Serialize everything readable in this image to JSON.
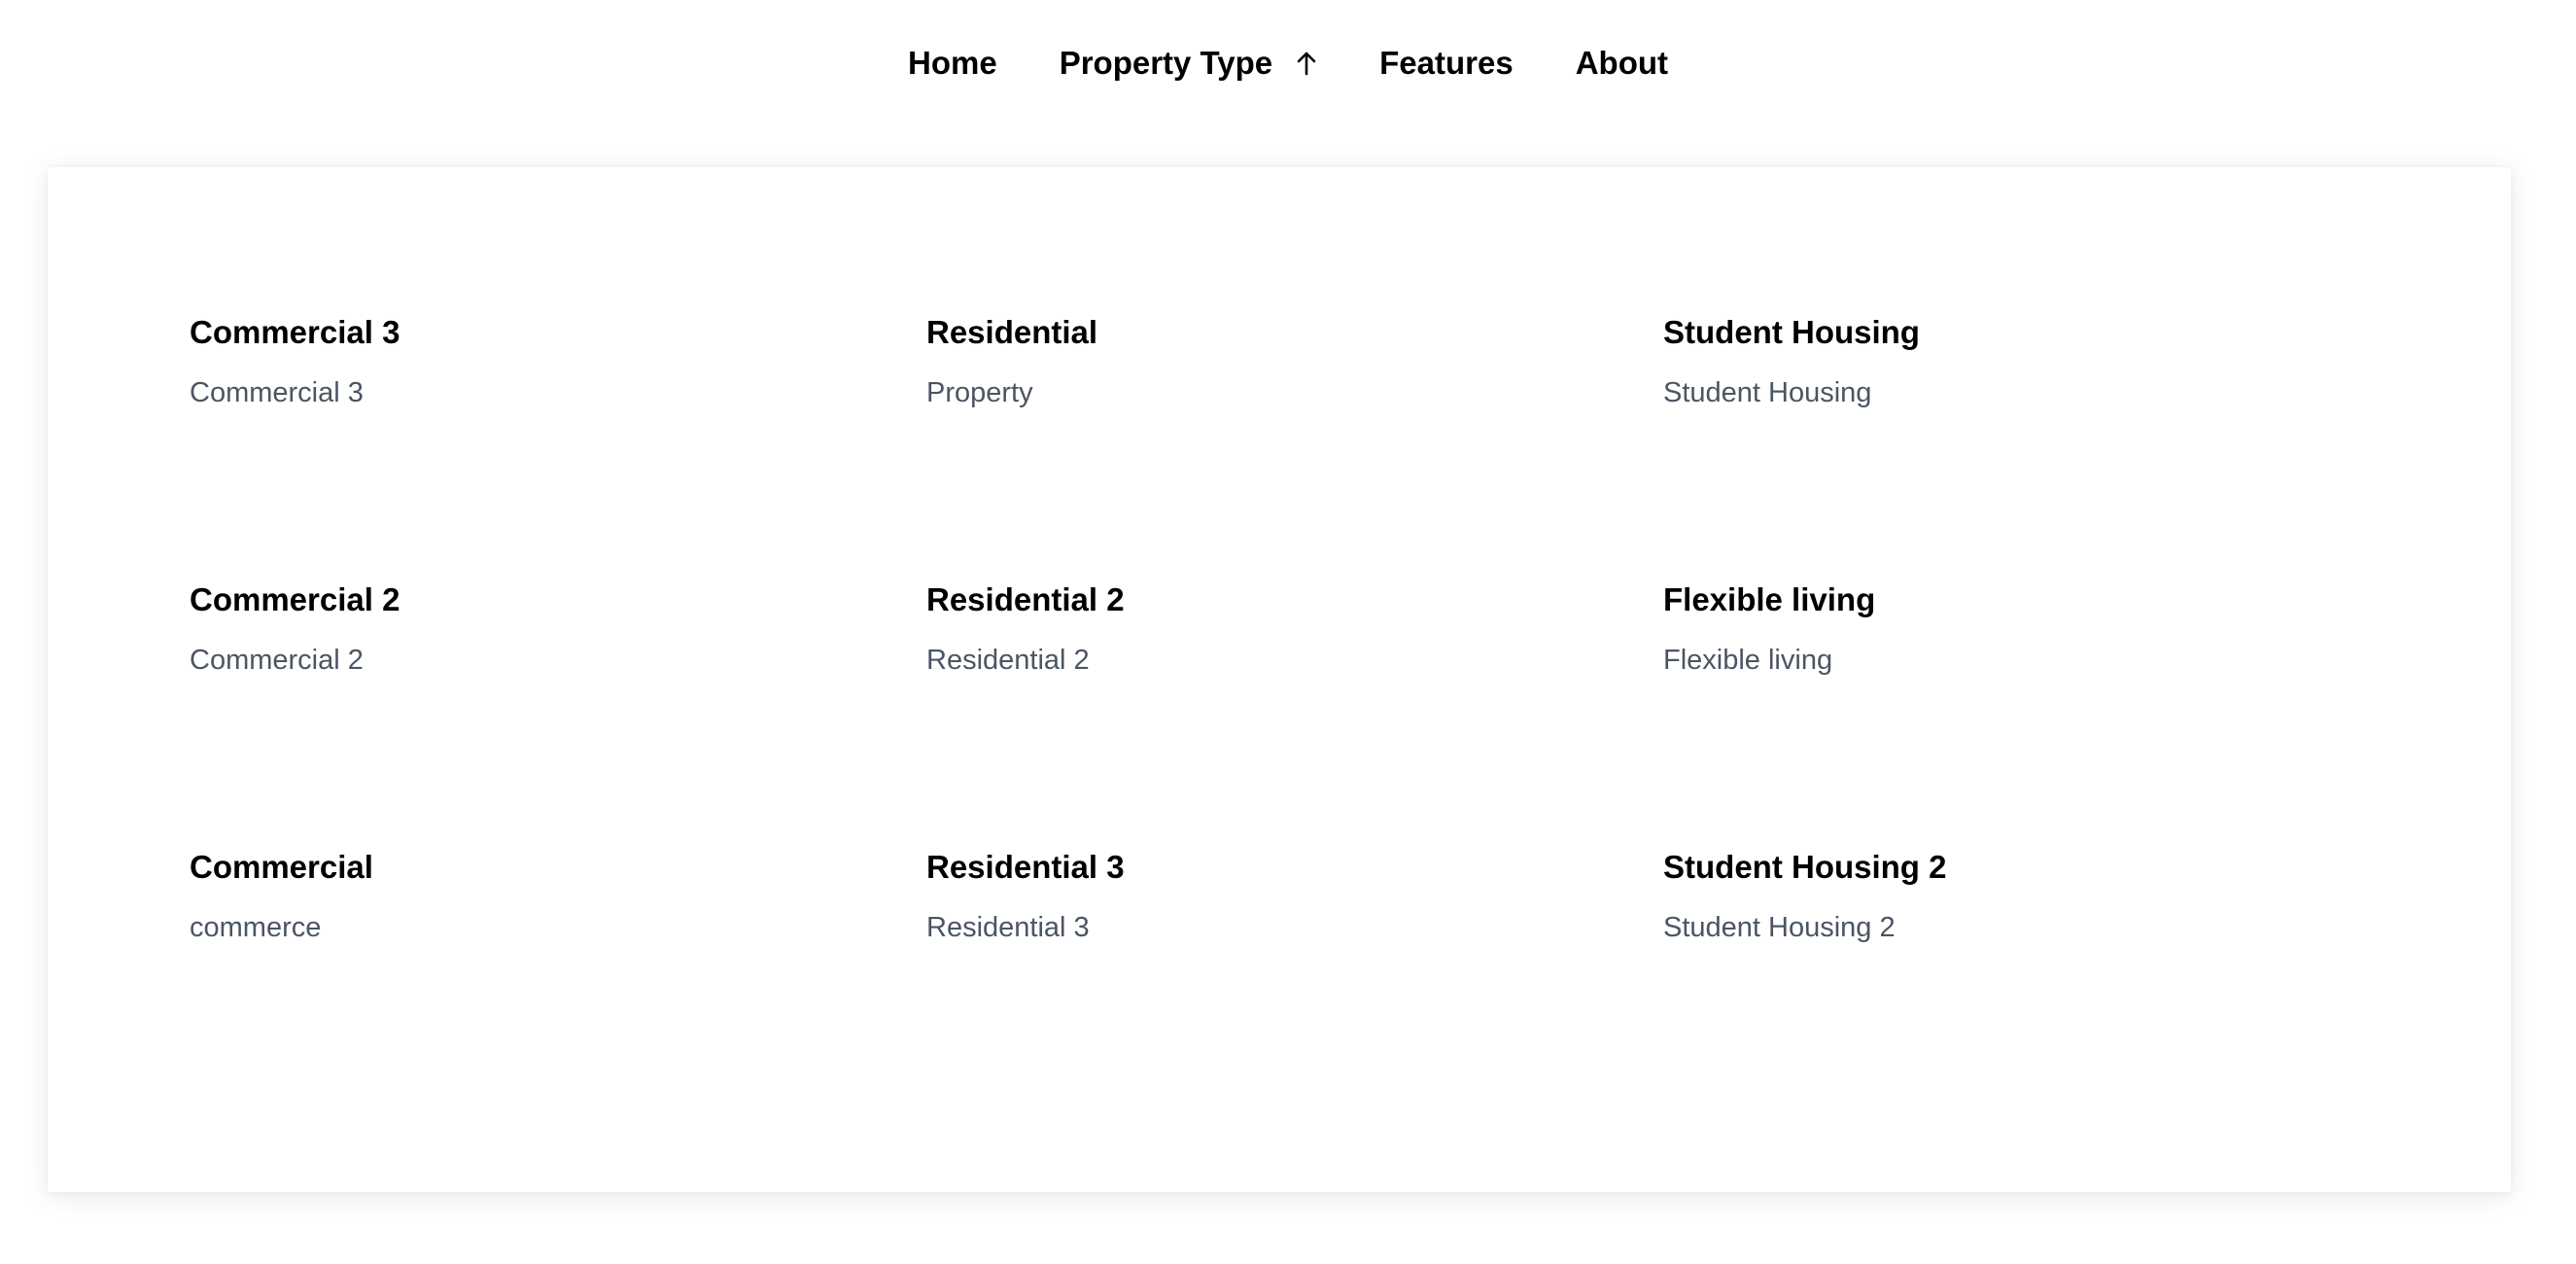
{
  "nav": {
    "items": [
      {
        "label": "Home"
      },
      {
        "label": "Property Type",
        "icon": "arrow-up-icon"
      },
      {
        "label": "Features"
      },
      {
        "label": "About"
      }
    ]
  },
  "colors": {
    "title": "#000000",
    "subtitle": "#4b5563",
    "background": "#ffffff"
  },
  "menu": {
    "items": [
      {
        "title": "Commercial 3",
        "subtitle": "Commercial 3"
      },
      {
        "title": "Residential",
        "subtitle": "Property"
      },
      {
        "title": "Student Housing",
        "subtitle": "Student Housing"
      },
      {
        "title": "Commercial 2",
        "subtitle": "Commercial 2"
      },
      {
        "title": "Residential 2",
        "subtitle": "Residential 2"
      },
      {
        "title": "Flexible living",
        "subtitle": "Flexible living"
      },
      {
        "title": "Commercial",
        "subtitle": "commerce"
      },
      {
        "title": "Residential 3",
        "subtitle": "Residential 3"
      },
      {
        "title": "Student Housing 2",
        "subtitle": "Student Housing 2"
      }
    ]
  }
}
